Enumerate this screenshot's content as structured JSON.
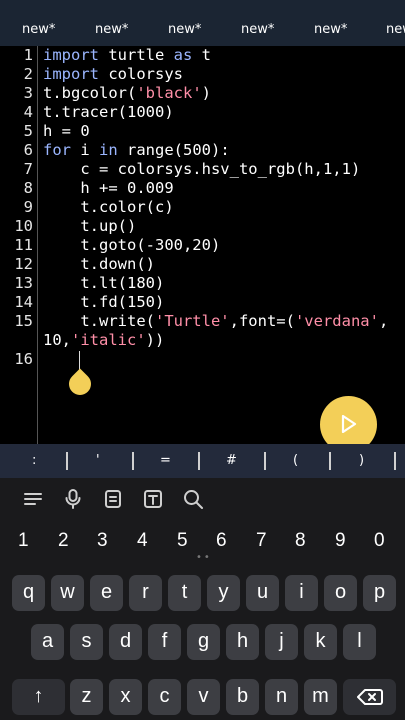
{
  "tabs": [
    "new*",
    "new*",
    "new*",
    "new*",
    "new*",
    "new*"
  ],
  "editor": {
    "line_numbers": [
      "1",
      "2",
      "3",
      "4",
      "5",
      "6",
      "7",
      "8",
      "9",
      "10",
      "11",
      "12",
      "13",
      "14",
      "15",
      "",
      "16"
    ]
  },
  "code": {
    "l1": {
      "kw1": "import",
      "rest": " turtle ",
      "kw2": "as",
      "end": " t"
    },
    "l2": {
      "kw1": "import",
      "rest": " colorsys"
    },
    "l3": {
      "pre": "t.bgcolor(",
      "str": "'black'",
      "post": ")"
    },
    "l4": "t.tracer(1000)",
    "l5": "h = 0",
    "l6": {
      "kw1": "for",
      "mid1": " i ",
      "kw2": "in",
      "mid2": " range(500):"
    },
    "l7": "    c = colorsys.hsv_to_rgb(h,1,1)",
    "l8": "    h += 0.009",
    "l9": "    t.color(c)",
    "l10": "    t.up()",
    "l11": "    t.goto(-300,20)",
    "l12": "    t.down()",
    "l13": "    t.lt(180)",
    "l14": "    t.fd(150)",
    "l15": {
      "pre": "    t.write(",
      "str1": "'Turtle'",
      "mid": ",font=(",
      "str2": "'verdana'",
      "post": ","
    },
    "l15b": {
      "pre": "10,",
      "str": "'italic'",
      "post": "))"
    }
  },
  "symbols": [
    ":",
    "'",
    "=",
    "#",
    "(",
    ")"
  ],
  "keyboard": {
    "numbers": [
      "1",
      "2",
      "3",
      "4",
      "5",
      "6",
      "7",
      "8",
      "9",
      "0"
    ],
    "row1": [
      "q",
      "w",
      "e",
      "r",
      "t",
      "y",
      "u",
      "i",
      "o",
      "p"
    ],
    "row2": [
      "a",
      "s",
      "d",
      "f",
      "g",
      "h",
      "j",
      "k",
      "l"
    ],
    "row3": [
      "z",
      "x",
      "c",
      "v",
      "b",
      "n",
      "m"
    ],
    "shift_symbol": "↑",
    "backspace_icon": "backspace-icon"
  },
  "colors": {
    "accent": "#f3cf58",
    "keyword": "#9bb6ff",
    "string": "#ff8fa8",
    "tabbar": "#1b2533"
  }
}
